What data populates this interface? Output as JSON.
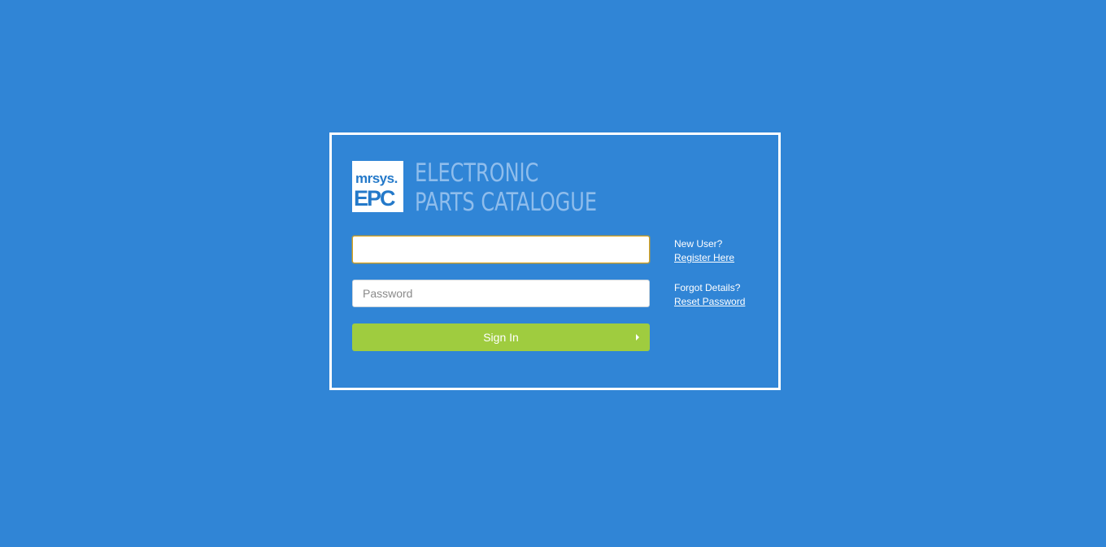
{
  "logo": {
    "brand": "mrsys.",
    "product": "EPC",
    "title_line1": "ELECTRONIC",
    "title_line2": "PARTS CATALOGUE"
  },
  "form": {
    "username_value": "",
    "username_placeholder": "",
    "password_placeholder": "Password",
    "signin_label": "Sign In"
  },
  "side_links": {
    "new_user_label": "New User?",
    "register_link": "Register Here",
    "forgot_label": "Forgot Details?",
    "reset_link": "Reset Password"
  },
  "colors": {
    "background": "#3085d6",
    "signin_button": "#9fcc3f",
    "focus_border": "#d9a21b"
  }
}
